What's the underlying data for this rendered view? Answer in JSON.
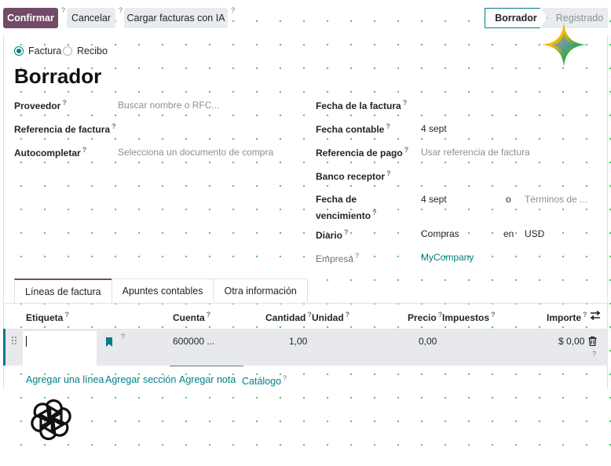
{
  "toolbar": {
    "confirm_label": "Confirmar",
    "cancel_label": "Cancelar",
    "upload_ai_label": "Cargar facturas con IA",
    "help_mark": "?"
  },
  "statusbar": {
    "active": "Borrador",
    "next": "Registrado"
  },
  "move_type": {
    "options": [
      "Factura",
      "Recibo"
    ],
    "selected": "Factura"
  },
  "record_title": "Borrador",
  "left_fields": {
    "vendor_label": "Proveedor",
    "vendor_placeholder": "Buscar nombre o RFC...",
    "ref_label": "Referencia de factura",
    "autocomplete_label": "Autocompletar",
    "autocomplete_placeholder": "Selecciona un documento de compra"
  },
  "right_fields": {
    "invoice_date_label": "Fecha de la factura",
    "accounting_date_label": "Fecha contable",
    "accounting_date_value": "4 sept",
    "payment_ref_label": "Referencia de pago",
    "payment_ref_placeholder": "Usar referencia de factura",
    "bank_label": "Banco receptor",
    "due_date_label_line1": "Fecha de",
    "due_date_label_line2": "vencimiento",
    "due_date_value": "4 sept",
    "due_or": "o",
    "terms_placeholder": "Términos de ...",
    "journal_label": "Diario",
    "journal_value": "Compras",
    "journal_in": "en",
    "currency_value": "USD",
    "company_label": "Empresa",
    "company_value": "MyCompany"
  },
  "tabs": [
    "Líneas de factura",
    "Apuntes contables",
    "Otra información"
  ],
  "table": {
    "headers": {
      "label": "Etiqueta",
      "account": "Cuenta",
      "quantity": "Cantidad",
      "unit": "Unidad",
      "price": "Precio",
      "taxes": "Impuestos",
      "amount": "Importe"
    },
    "row": {
      "account": "600000 ...",
      "quantity": "1,00",
      "price": "0,00",
      "amount": "$ 0,00"
    },
    "actions": {
      "add_line": "Agregar una línea",
      "add_section": "Agregar sección",
      "add_note": "Agregar nota",
      "catalog": "Catálogo"
    }
  },
  "colors": {
    "primary": "#714b67",
    "accent": "#017e84"
  },
  "icons": [
    "settings-toggle-icon",
    "drag-handle-icon",
    "bookmark-icon",
    "trash-icon",
    "gemini-icon",
    "openai-icon"
  ]
}
